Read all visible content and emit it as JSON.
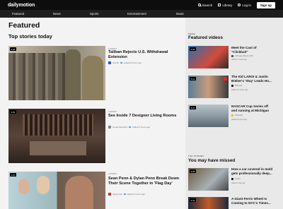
{
  "header": {
    "logo": "dailymotion",
    "search": "Search",
    "library": "Library",
    "login": "Log in",
    "signup": "Sign up"
  },
  "subnav": [
    "Featured",
    "News",
    "Sports",
    "Entertainment",
    "Music"
  ],
  "main": {
    "title": "Featured",
    "section": "Top stories today",
    "stories": [
      {
        "duration": "3:35",
        "kicker": "LATEST",
        "title": "Taliban Rejects U.S. Withdrawal Extension",
        "channel": "Wochit",
        "time": "Added 8 hours ago"
      },
      {
        "duration": "4:51",
        "kicker": "LATEST",
        "title": "See Inside 7 Designer Living Rooms",
        "channel": "House Beautiful",
        "time": "Added 6 hours ago"
      },
      {
        "duration": "1:27",
        "kicker": "LATEST",
        "title": "Sean Penn & Dylan Penn Break Down Their Scene Together in 'Flag Day'",
        "channel": "Vanity Fair",
        "time": "Added 5 hours ago"
      }
    ]
  },
  "sidebar": {
    "featured_tag": "MORE",
    "featured_title": "Featured videos",
    "featured": [
      {
        "duration": "3:35",
        "title": "Meet the Cast of \"Clickbait\"",
        "channel": "Chinwag Alliance 2021",
        "time": "Added 7 hours ago"
      },
      {
        "duration": "3:21",
        "title": "The Kid LAROI & Justin Bieber's 'Stay' Leads Ho...",
        "channel": "Billboard",
        "time": "Added 14 hours ago"
      },
      {
        "duration": "3:27",
        "title": "NASCAR Cup Series off and running at Michigan",
        "channel": "NASCAR",
        "time": "Added 2 hours ago"
      }
    ],
    "missed_tag": "TOP STORIES",
    "missed_title": "You may have missed",
    "missed": [
      {
        "duration": "3:05",
        "title": "How a car covered in mold gets professionally deep...",
        "channel": "Insider",
        "time": "Added 1 day ago"
      },
      {
        "duration": "2:41",
        "title": "A Giant Ferris Wheel Is Coming to NYC's Times...",
        "channel": "",
        "time": ""
      }
    ]
  }
}
